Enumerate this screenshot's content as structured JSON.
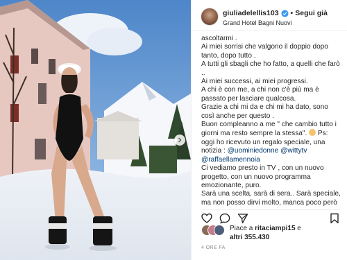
{
  "post": {
    "username": "giuliadelellis103",
    "follow_label": "Segui già",
    "separator": "•",
    "location": "Grand Hotel Bagni Nuovi"
  },
  "caption": {
    "lines": [
      "ascoltarmi .",
      "Ai miei sorrisi che valgono il doppio dopo tanto, dopo tutto .",
      "A tutti gli sbagli che ho fatto, a quelli che farò ..",
      "Ai miei successi, ai miei progressi.",
      "A chi è con me, a chi non c'è più ma è passato per lasciare qualcosa.",
      "Grazie a chi mi da e chi mi ha dato, sono così anche per questo .",
      "Buon compleanno a me \" che cambio tutto i giorni ma resto sempre la stessa\". ",
      " Ps: oggi ho ricevuto un regalo speciale, una notizia : ",
      "Ci vediamo presto in TV , con un nuovo progetto, con un nuovo programma emozionante, puro.",
      "Sarà una scelta, sarà di sera.. Sarà speciale, ma non posso dirvi molto, manca poco però"
    ],
    "mention_1": "@uominiedonne",
    "mention_2": "@wittytv",
    "mention_3": "@raffaellamennoia"
  },
  "likes": {
    "prefix": "Piace a ",
    "user": "ritaciampi15",
    "suffix": " e",
    "others": "altri 355.430"
  },
  "timestamp": "4 ORE FA",
  "icons": [
    "verified-badge-icon",
    "chevron-right-icon",
    "heart-icon",
    "comment-icon",
    "share-icon",
    "bookmark-icon",
    "emoji-icon"
  ],
  "colors": {
    "link": "#003569",
    "verified": "#3897f0",
    "text": "#262626",
    "muted": "#8e8e8e"
  }
}
